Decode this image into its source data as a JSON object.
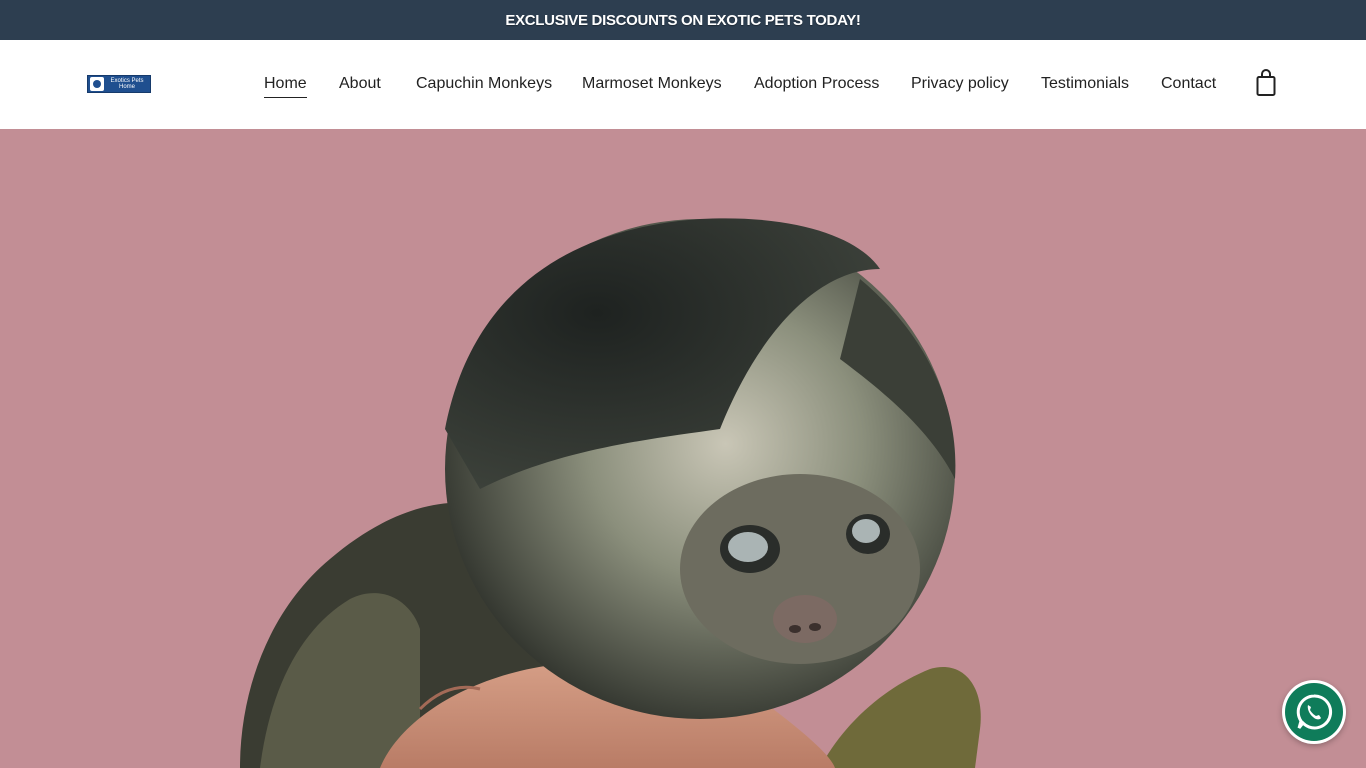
{
  "promo": {
    "text": "EXCLUSIVE DISCOUNTS ON EXOTIC PETS TODAY!"
  },
  "logo": {
    "text": "Exotics Pets Home",
    "icon": "logo-mark"
  },
  "nav": {
    "items": [
      {
        "label": "Home",
        "active": true
      },
      {
        "label": "About"
      },
      {
        "label": "Capuchin Monkeys"
      },
      {
        "label": "Marmoset Monkeys"
      },
      {
        "label": "Adoption Process"
      },
      {
        "label": "Privacy policy"
      },
      {
        "label": "Testimonials"
      },
      {
        "label": "Contact"
      }
    ],
    "cart_icon": "shopping-bag-icon"
  },
  "hero": {
    "image": "baby-marmoset-monkey-on-hand"
  },
  "whatsapp": {
    "icon": "whatsapp-icon",
    "color": "#0f7c5a"
  },
  "colors": {
    "promo_bg": "#2d3e50",
    "hero_bg": "#c28e95"
  }
}
